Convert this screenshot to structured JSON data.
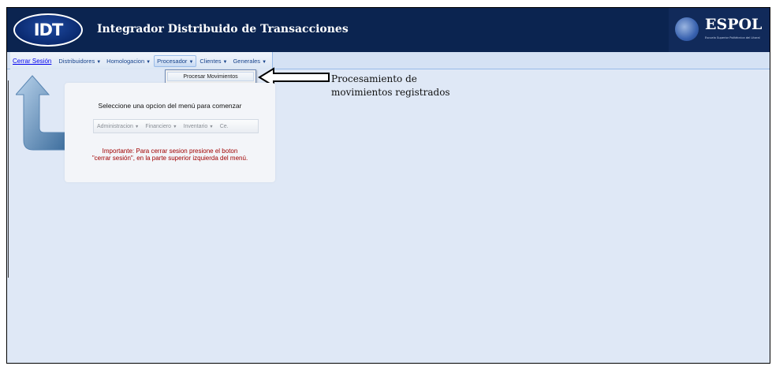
{
  "header": {
    "logo_text": "IDT",
    "title": "Integrador Distribuido de Transacciones",
    "partner_logo_text": "ESPOL",
    "partner_subtitle": "Escuela Superior Politécnica del Litoral",
    "background_color": "#0b2450"
  },
  "menubar": {
    "logout": "Cerrar Sesión",
    "items": [
      {
        "label": "Distribuidores",
        "arrow": "▼"
      },
      {
        "label": "Homologacion",
        "arrow": "▼"
      },
      {
        "label": "Procesador",
        "arrow": "▼",
        "active": true
      },
      {
        "label": "Clientes",
        "arrow": "▼"
      },
      {
        "label": "Generales",
        "arrow": "▼"
      }
    ]
  },
  "dropdown": {
    "items": [
      "Procesar Movimientos"
    ]
  },
  "annotation": {
    "text_line1": "Procesamiento de",
    "text_line2": "movimientos registrados"
  },
  "panel": {
    "title": "Seleccione una opcion del menú para comenzar",
    "sample_menu": [
      {
        "label": "Administracion",
        "arrow": "▼"
      },
      {
        "label": "Financiero",
        "arrow": "▼"
      },
      {
        "label": "Inventario",
        "arrow": "▼"
      },
      {
        "label": "Ce.",
        "arrow": ""
      }
    ],
    "note_line1": "Importante: Para cerrar sesion presione el boton",
    "note_line2": "\"cerrar sesión\", en la parte superior izquierda del menú.",
    "note_color": "#a00000"
  },
  "icons": [
    "up-arrow-icon",
    "callout-arrow-icon",
    "espol-emblem-icon"
  ]
}
